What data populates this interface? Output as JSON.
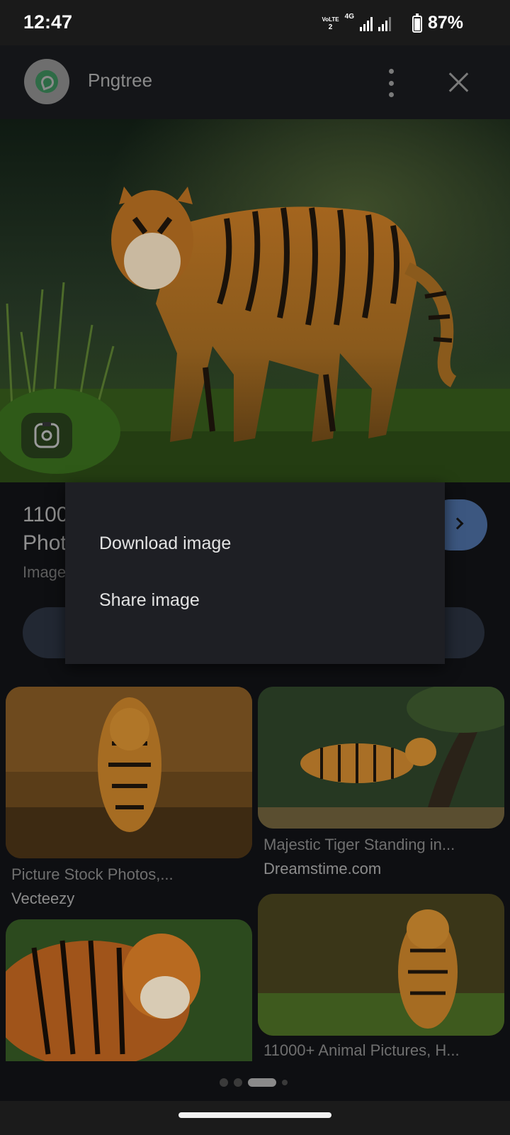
{
  "status_bar": {
    "time": "12:47",
    "volte_top": "VoLTE",
    "volte_bottom": "2",
    "network": "4G",
    "battery": "87%"
  },
  "header": {
    "source_name": "Pngtree",
    "icons": [
      "more-vert-icon",
      "close-icon"
    ]
  },
  "details": {
    "title_line1": "1100",
    "title_line2": "Phot",
    "subline": "Image"
  },
  "menu": {
    "items": [
      {
        "label": "Download image"
      },
      {
        "label": "Share image"
      }
    ]
  },
  "related": [
    {
      "caption": "Picture Stock Photos,...",
      "source": "Vecteezy"
    },
    {
      "caption": "Majestic Tiger Standing in...",
      "source": "Dreamstime.com"
    },
    {
      "caption": "",
      "source": ""
    },
    {
      "caption": "11000+ Animal Pictures, H...",
      "source": ""
    }
  ],
  "colors": {
    "background": "#0e0f12",
    "menu": "#1e1f24",
    "accent": "#3c5780"
  }
}
